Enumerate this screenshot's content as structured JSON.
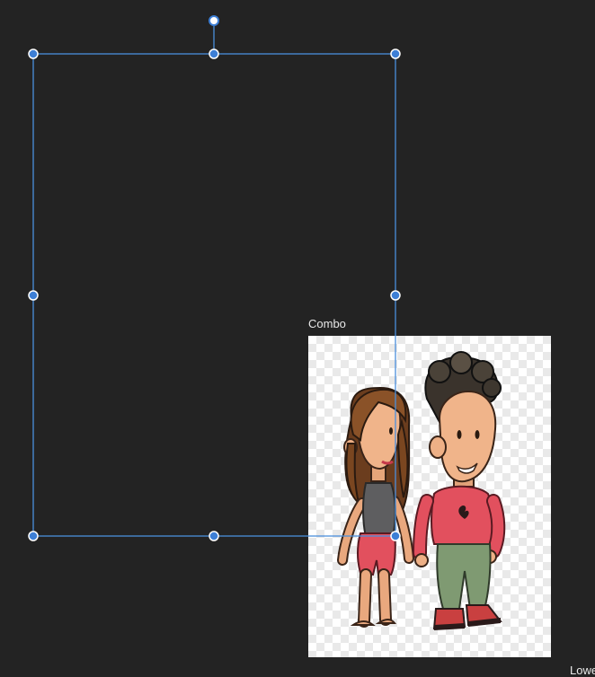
{
  "nodes": [
    {
      "label": "Combo"
    },
    {
      "label": "Lower"
    }
  ],
  "colors": {
    "canvas_background": "#232323",
    "selection_stroke": "#4a8fdc",
    "handle_fill": "#3d7fd6",
    "handle_stroke": "#ffffff"
  },
  "icons": {
    "rotate_handle": "rotate-handle-icon",
    "resize_handle": "resize-handle-icon"
  }
}
